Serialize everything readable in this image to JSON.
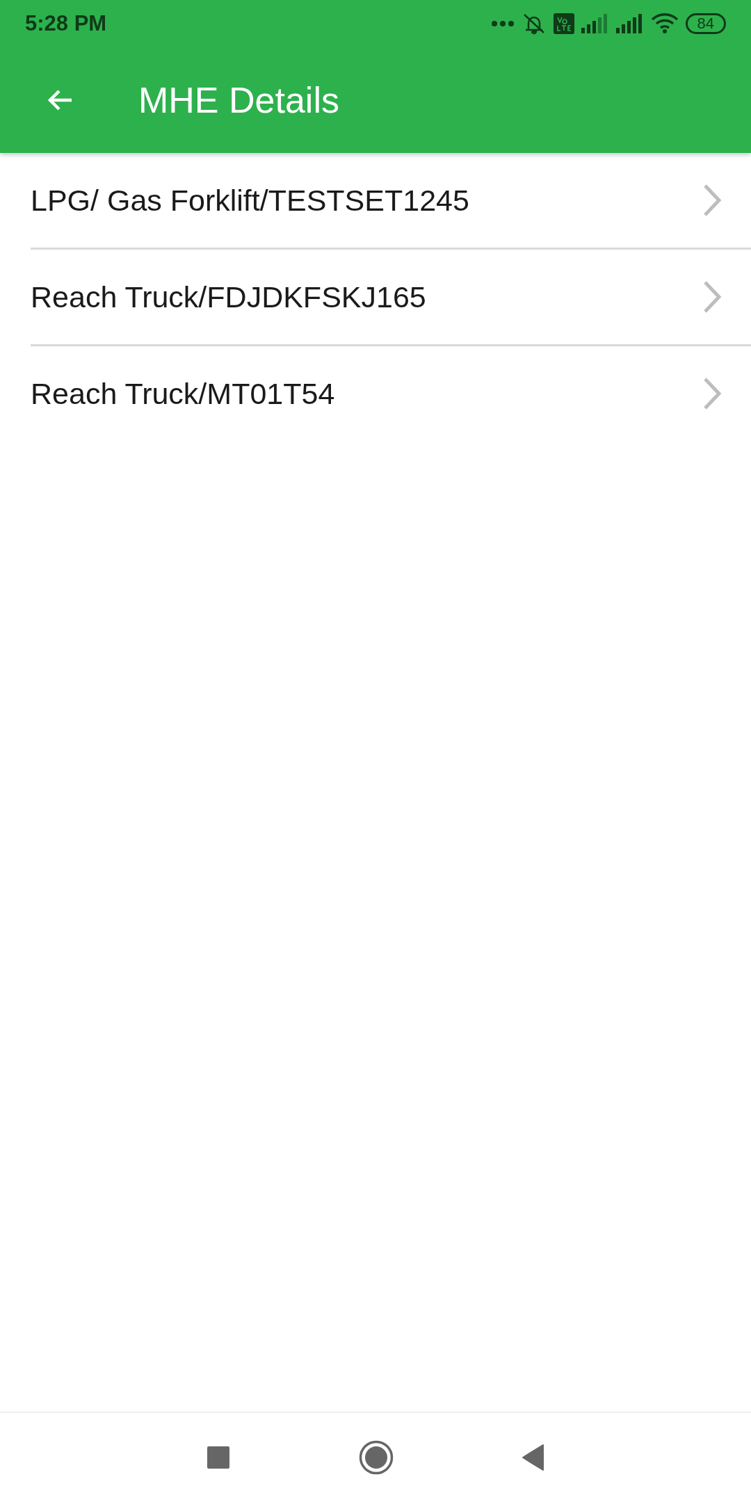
{
  "status_bar": {
    "time": "5:28 PM",
    "battery": "84"
  },
  "app_bar": {
    "title": "MHE Details"
  },
  "items": [
    {
      "label": "LPG/ Gas Forklift/TESTSET1245"
    },
    {
      "label": "Reach Truck/FDJDKFSKJ165"
    },
    {
      "label": "Reach Truck/MT01T54"
    }
  ]
}
